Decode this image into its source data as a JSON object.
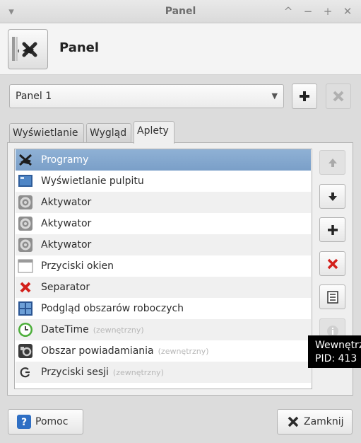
{
  "window": {
    "title": "Panel",
    "menu_glyph": "▾",
    "controls": [
      "^",
      "−",
      "+",
      "✕"
    ]
  },
  "header": {
    "title": "Panel",
    "icon": "panel-preferences-icon"
  },
  "panel_select": {
    "selected": "Panel 1",
    "add_icon": "plus-icon",
    "remove_icon": "remove-x-icon"
  },
  "tabs": [
    {
      "label": "Wyświetlanie",
      "active": false
    },
    {
      "label": "Wygląd",
      "active": false
    },
    {
      "label": "Aplety",
      "active": true
    }
  ],
  "applets": [
    {
      "name": "Programy",
      "ext": "",
      "icon": "applications-menu-icon",
      "selected": true
    },
    {
      "name": "Wyświetlanie pulpitu",
      "ext": "",
      "icon": "show-desktop-icon"
    },
    {
      "name": "Aktywator",
      "ext": "",
      "icon": "launcher-icon"
    },
    {
      "name": "Aktywator",
      "ext": "",
      "icon": "launcher-icon"
    },
    {
      "name": "Aktywator",
      "ext": "",
      "icon": "launcher-icon"
    },
    {
      "name": "Przyciski okien",
      "ext": "",
      "icon": "window-buttons-icon"
    },
    {
      "name": "Separator",
      "ext": "",
      "icon": "separator-icon"
    },
    {
      "name": "Podgląd obszarów roboczych",
      "ext": "",
      "icon": "workspace-switcher-icon"
    },
    {
      "name": "DateTime",
      "ext": "(zewnętrzny)",
      "icon": "clock-icon"
    },
    {
      "name": "Obszar powiadamiania",
      "ext": "(zewnętrzny)",
      "icon": "notification-area-icon"
    },
    {
      "name": "Przyciski sesji",
      "ext": "(zewnętrzny)",
      "icon": "session-icon"
    }
  ],
  "side_buttons": [
    {
      "icon": "move-up-icon",
      "enabled": false
    },
    {
      "icon": "move-down-icon",
      "enabled": true
    },
    {
      "icon": "add-applet-icon",
      "enabled": true
    },
    {
      "icon": "remove-applet-icon",
      "enabled": true
    },
    {
      "icon": "preferences-icon",
      "enabled": true
    },
    {
      "icon": "about-icon",
      "enabled": false
    }
  ],
  "tooltip": {
    "line1": "Wewnętrz",
    "line2": "PID: 413"
  },
  "footer": {
    "help_label": "Pomoc",
    "close_label": "Zamknij"
  },
  "colors": {
    "selection": "#7a9fc8",
    "remove_red": "#d3201b",
    "help_blue": "#2f6fc4"
  }
}
